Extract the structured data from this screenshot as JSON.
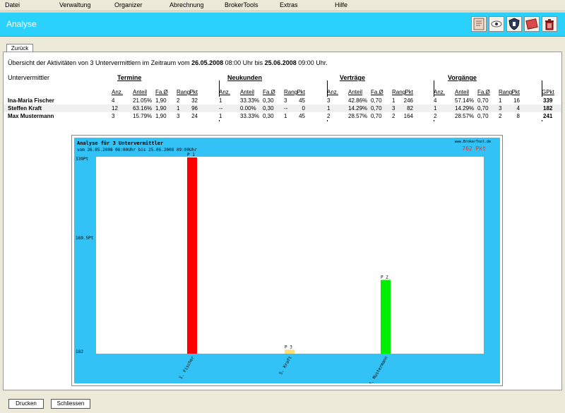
{
  "menu": [
    "Datei",
    "Verwaltung",
    "Organizer",
    "Abrechnung",
    "BrokerTools",
    "Extras",
    "Hilfe"
  ],
  "app_title": "Analyse",
  "toolbar": {
    "icons": [
      "document-icon",
      "eye-icon",
      "shield-icon",
      "card-icon",
      "trash-icon"
    ],
    "accent": "#29d1fb"
  },
  "tab": {
    "label": "Zurück"
  },
  "summary": {
    "prefix": "Übersicht der Aktivitäten von 3 Untervermittlern im Zeitraum vom ",
    "from_date": "26.05.2008",
    "from_time": " 08:00 Uhr bis ",
    "to_date": "25.06.2008",
    "to_time": " 09:00 Uhr."
  },
  "table": {
    "name_header": "Untervermittler",
    "groups": [
      "Termine",
      "Neukunden",
      "Verträge",
      "Vorgänge"
    ],
    "sub_headers": [
      "Anz.",
      "Anteil",
      "Fa.Ø",
      "Rang",
      "Pkt"
    ],
    "total_header": "GPkt",
    "rows": [
      {
        "name": "Ina-Maria Fischer",
        "groups": [
          [
            "4",
            "21.05%",
            "1,90",
            "2",
            "32"
          ],
          [
            "1",
            "33.33%",
            "0,30",
            "3",
            "45"
          ],
          [
            "3",
            "42.86%",
            "0,70",
            "1",
            "246"
          ],
          [
            "4",
            "57.14%",
            "0,70",
            "1",
            "16"
          ]
        ],
        "total": "339"
      },
      {
        "name": "Steffen Kraft",
        "groups": [
          [
            "12",
            "63.16%",
            "1,90",
            "1",
            "96"
          ],
          [
            "--",
            "0.00%",
            "0,30",
            "--",
            "0"
          ],
          [
            "1",
            "14.29%",
            "0,70",
            "3",
            "82"
          ],
          [
            "1",
            "14.29%",
            "0,70",
            "3",
            "4"
          ]
        ],
        "total": "182"
      },
      {
        "name": "Max Mustermann",
        "groups": [
          [
            "3",
            "15.79%",
            "1,90",
            "3",
            "24"
          ],
          [
            "1",
            "33.33%",
            "0,30",
            "1",
            "45"
          ],
          [
            "2",
            "28.57%",
            "0,70",
            "2",
            "164"
          ],
          [
            "2",
            "28.57%",
            "0,70",
            "2",
            "8"
          ]
        ],
        "total": "241"
      }
    ]
  },
  "chart_data": {
    "type": "bar",
    "title": "Analyse für 3 Untervermittler",
    "subtitle": "vom 26.05.2008 08:00Uhr bis 25.06.2008 09:00Uhr",
    "brand": "www.BrokerTool.de",
    "total_label": "762 Pkt",
    "categories": [
      "I. Fischer",
      "S. Kraft",
      "M. Mustermann"
    ],
    "values": [
      339,
      182,
      241
    ],
    "bar_labels": [
      "P 1",
      "P 3",
      "P 2"
    ],
    "colors": [
      "#ff0000",
      "#ffdd77",
      "#00ee00"
    ],
    "ylim": [
      182,
      339
    ],
    "yticks": [
      "339Pt",
      "169.5Pt",
      "182"
    ],
    "grid": false
  },
  "buttons": {
    "print": "Drucken",
    "close": "Schliessen"
  }
}
